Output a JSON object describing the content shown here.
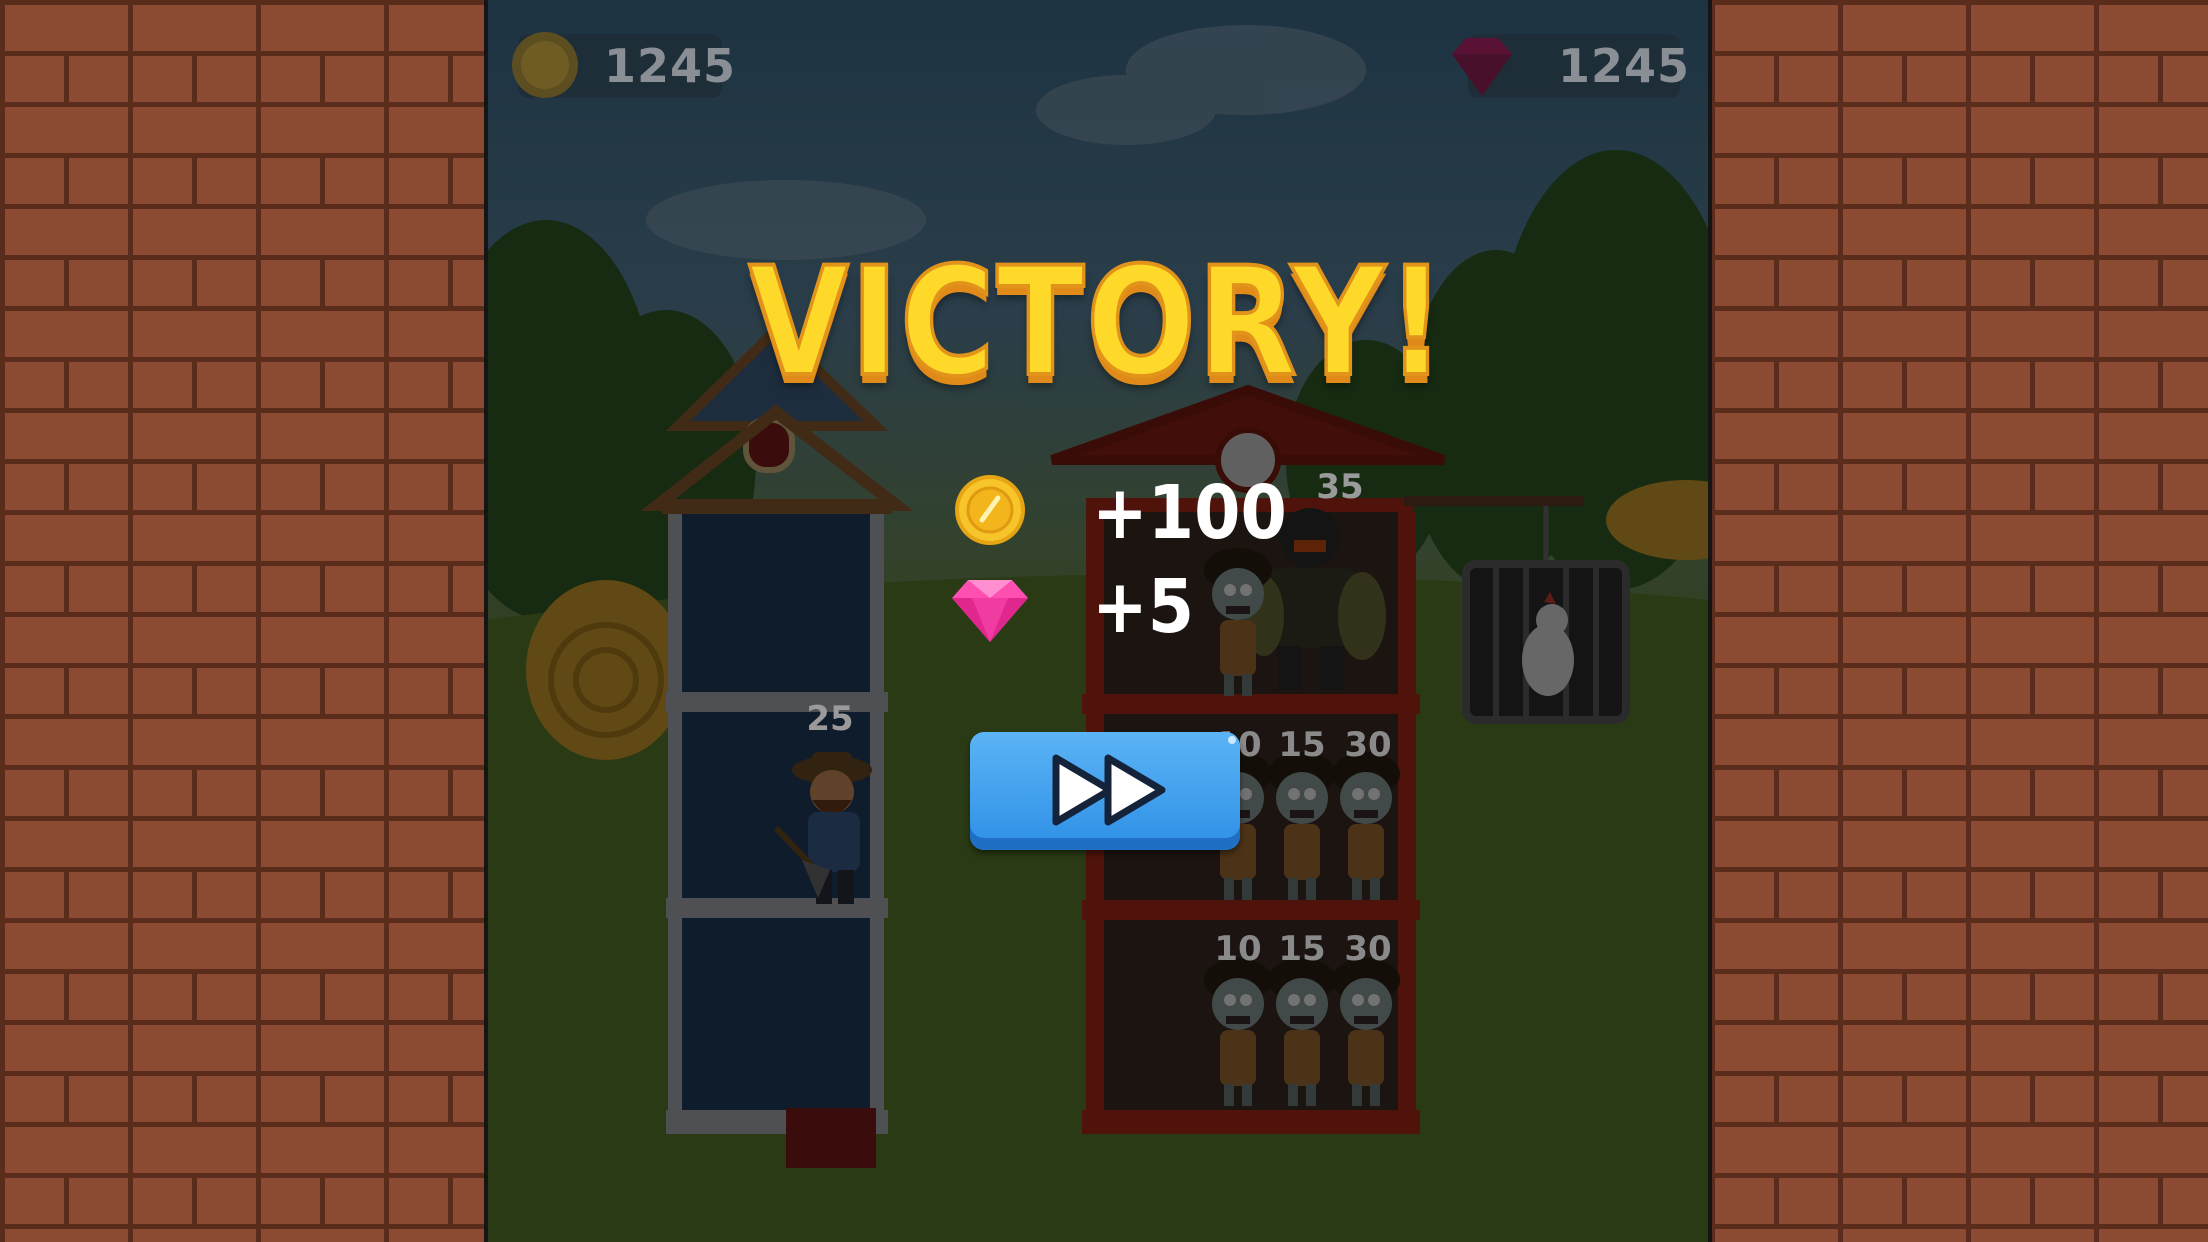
{
  "hud": {
    "coins": "1245",
    "gems": "1245"
  },
  "victory": {
    "title": "VICTORY!",
    "coin_reward": "+100",
    "gem_reward": "+5"
  },
  "player": {
    "power": "25"
  },
  "enemy_tower": {
    "floor_1": {
      "power_labels": [
        "35"
      ]
    },
    "floor_2": {
      "power_labels": [
        "10",
        "15",
        "30"
      ]
    },
    "floor_3": {
      "power_labels": [
        "10",
        "15",
        "30"
      ]
    }
  },
  "icons": {
    "coin": "coin-icon",
    "gem": "gem-icon",
    "next": "fast-forward-icon"
  },
  "colors": {
    "title_fill": "#ffd92a",
    "title_shadow": "#e08a1a",
    "button_blue": "#3a9cf0",
    "gem_pink": "#e62e8f",
    "coin_gold": "#f2b51c"
  }
}
